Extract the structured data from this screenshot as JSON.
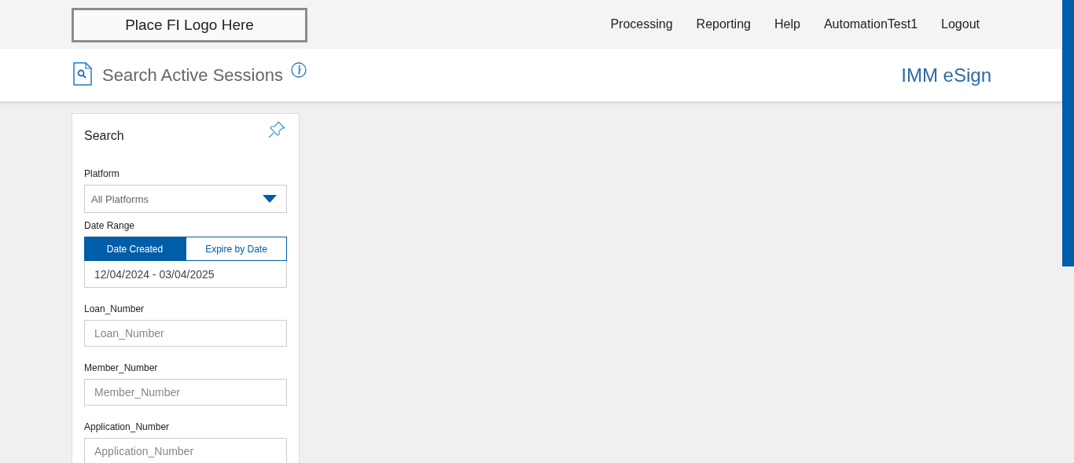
{
  "header": {
    "logo": "Place FI Logo Here",
    "nav": [
      {
        "label": "Processing"
      },
      {
        "label": "Reporting"
      },
      {
        "label": "Help"
      },
      {
        "label": "AutomationTest1"
      },
      {
        "label": "Logout"
      }
    ]
  },
  "subheader": {
    "title": "Search Active Sessions",
    "product": "IMM eSign"
  },
  "search_panel": {
    "title": "Search",
    "platform": {
      "label": "Platform",
      "value": "All Platforms"
    },
    "date_range": {
      "label": "Date Range",
      "tabs": [
        {
          "label": "Date Created",
          "selected": true
        },
        {
          "label": "Expire by Date",
          "selected": false
        }
      ],
      "value": "12/04/2024 - 03/04/2025"
    },
    "fields": [
      {
        "label": "Loan_Number",
        "placeholder": "Loan_Number"
      },
      {
        "label": "Member_Number",
        "placeholder": "Member_Number"
      },
      {
        "label": "Application_Number",
        "placeholder": "Application_Number"
      }
    ]
  }
}
